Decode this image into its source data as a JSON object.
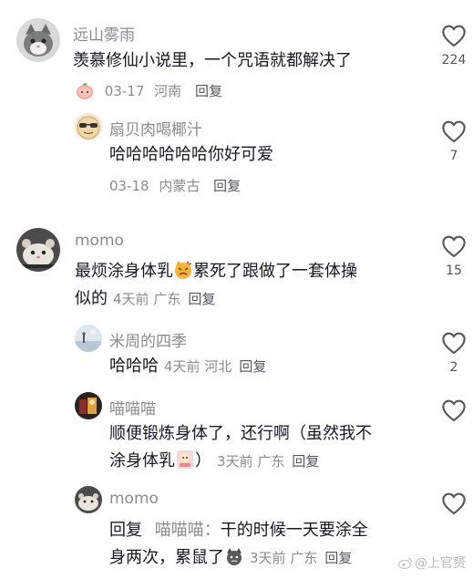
{
  "comments": [
    {
      "name": "远山雾雨",
      "text": "羡慕修仙小说里，一个咒语就都解决了",
      "date": "03-17",
      "location": "河南",
      "reply": "回复",
      "likes": "224"
    },
    {
      "name": "扇贝肉喝椰汁",
      "text": "哈哈哈哈哈哈你好可爱",
      "date": "03-18",
      "location": "内蒙古",
      "reply": "回复",
      "likes": "7"
    },
    {
      "name": "momo",
      "text_line1_a": "最烦涂身体乳",
      "text_line1_b": "累死了跟做了一套体操",
      "text_line2": "似的",
      "date": "4天前",
      "location": "广东",
      "reply": "回复",
      "likes": "15"
    },
    {
      "name": "米周的四季",
      "text": "哈哈哈",
      "date": "4天前",
      "location": "河北",
      "reply": "回复",
      "likes": "2"
    },
    {
      "name": "喵喵喵",
      "text_line1": "顺便锻炼身体了，还行啊（虽然我不",
      "text_line2_a": "涂身体乳",
      "text_line2_b": "）",
      "date": "3天前",
      "location": "广东",
      "reply": "回复"
    },
    {
      "name": "momo",
      "reply_prefix": "回复",
      "mention": "喵喵喵：",
      "text_line1": "干的时候一天要涂全",
      "text_line2_a": "身两次，累鼠了",
      "date": "3天前",
      "location": "广东",
      "reply": "回复"
    }
  ],
  "watermark": "@上官赟",
  "icons": {
    "like": "heart-outline-icon",
    "watermark": "weibo-logo-icon"
  },
  "colors": {
    "primary_text": "#161823",
    "secondary_text": "#8a8b91",
    "reply_text": "#55565c"
  }
}
